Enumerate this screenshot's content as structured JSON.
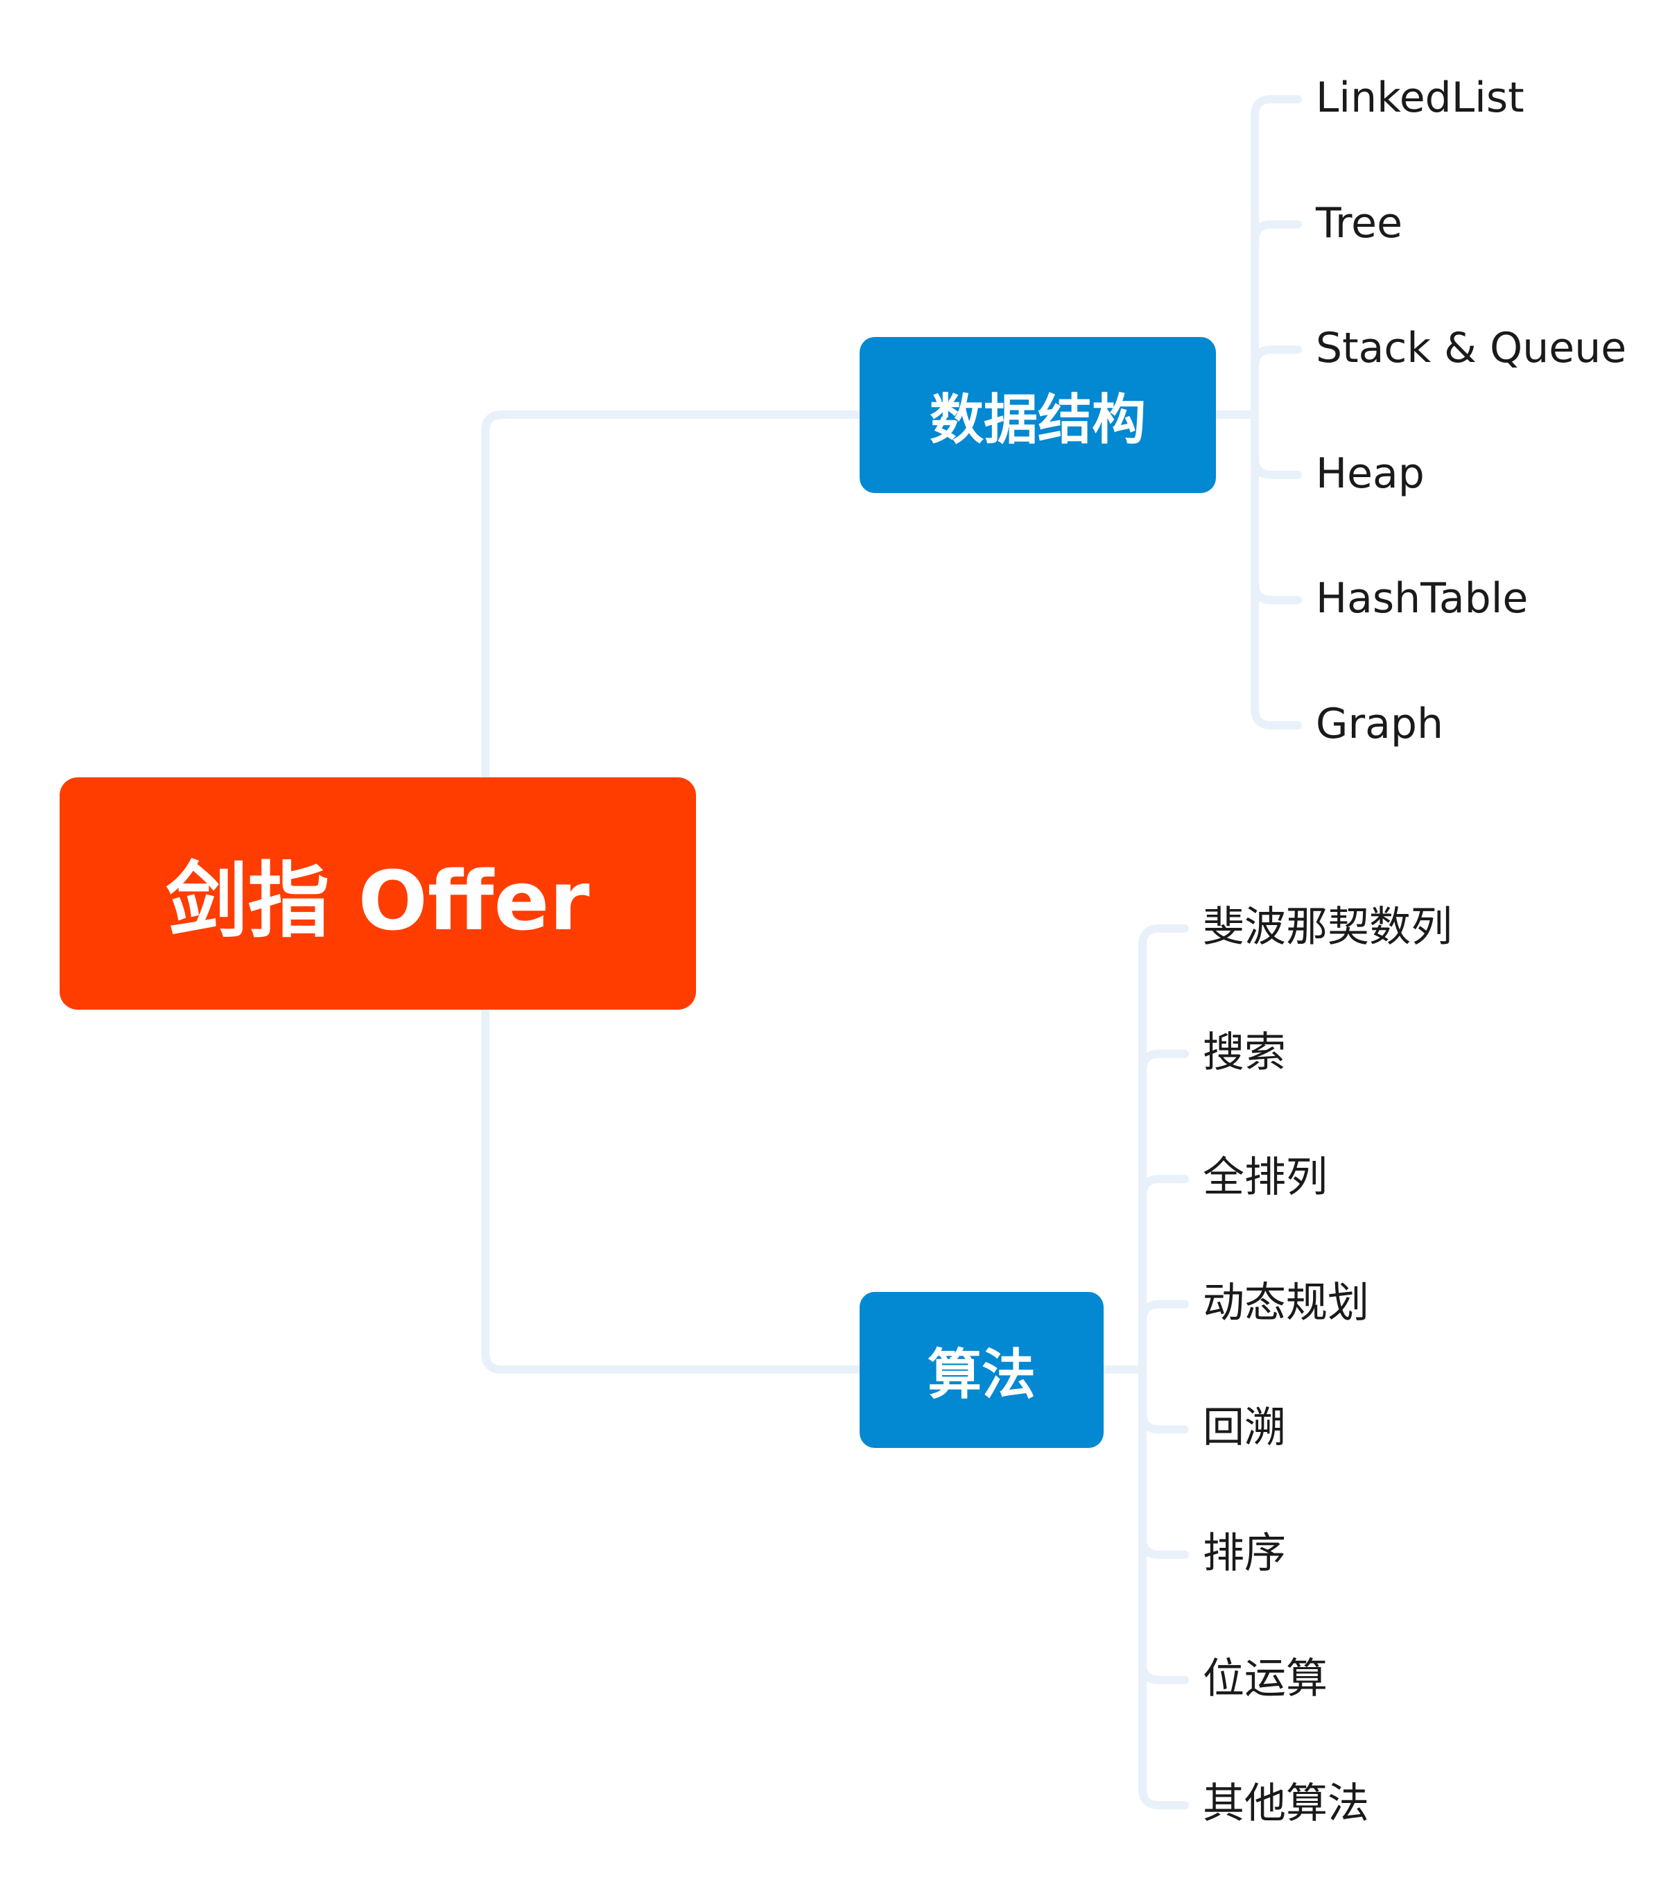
{
  "colors": {
    "root": "#ff3d00",
    "branch": "#0388d2",
    "connector": "#e8f1fa",
    "leaf_text": "#1a1a1a"
  },
  "root": {
    "label": "剑指 Offer"
  },
  "branches": [
    {
      "label": "数据结构",
      "leaves": [
        "LinkedList",
        "Tree",
        "Stack & Queue",
        "Heap",
        "HashTable",
        "Graph"
      ]
    },
    {
      "label": "算法",
      "leaves": [
        "斐波那契数列",
        "搜索",
        "全排列",
        "动态规划",
        "回溯",
        "排序",
        "位运算",
        "其他算法"
      ]
    }
  ]
}
